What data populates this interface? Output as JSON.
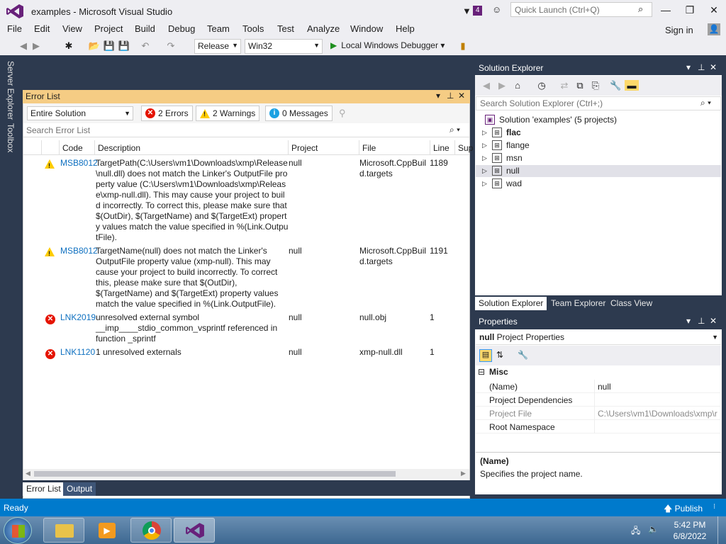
{
  "window": {
    "title": "examples - Microsoft Visual Studio",
    "notification_count": "4",
    "quick_launch_placeholder": "Quick Launch (Ctrl+Q)"
  },
  "menu": [
    "File",
    "Edit",
    "View",
    "Project",
    "Build",
    "Debug",
    "Team",
    "Tools",
    "Test",
    "Analyze",
    "Window",
    "Help"
  ],
  "signin": "Sign in",
  "toolbar": {
    "config": "Release",
    "platform": "Win32",
    "debugger": "Local Windows Debugger"
  },
  "side_tabs": [
    "Server Explorer",
    "Toolbox"
  ],
  "error_list": {
    "title": "Error List",
    "scope": "Entire Solution",
    "errors_filter": "2 Errors",
    "warnings_filter": "2 Warnings",
    "messages_filter": "0 Messages",
    "search_placeholder": "Search Error List",
    "columns": [
      "Code",
      "Description",
      "Project",
      "File",
      "Line",
      "Sup"
    ],
    "rows": [
      {
        "severity": "warning",
        "code": "MSB8012",
        "description": "TargetPath(C:\\Users\\vm1\\Downloads\\xmp\\Release\\null.dll) does not match the Linker's OutputFile property value (C:\\Users\\vm1\\Downloads\\xmp\\Release\\xmp-null.dll). This may cause your project to build incorrectly. To correct this, please make sure that $(OutDir), $(TargetName) and $(TargetExt) property values match the value specified in %(Link.OutputFile).",
        "project": "null",
        "file": "Microsoft.CppBuild.targets",
        "line": "1189"
      },
      {
        "severity": "warning",
        "code": "MSB8012",
        "description": "TargetName(null) does not match the Linker's OutputFile property value (xmp-null). This may cause your project to build incorrectly. To correct this, please make sure that $(OutDir), $(TargetName) and $(TargetExt) property values match the value specified in %(Link.OutputFile).",
        "project": "null",
        "file": "Microsoft.CppBuild.targets",
        "line": "1191"
      },
      {
        "severity": "error",
        "code": "LNK2019",
        "description": "unresolved external symbol __imp____stdio_common_vsprintf referenced in function _sprintf",
        "project": "null",
        "file": "null.obj",
        "line": "1"
      },
      {
        "severity": "error",
        "code": "LNK1120",
        "description": "1 unresolved externals",
        "project": "null",
        "file": "xmp-null.dll",
        "line": "1"
      }
    ],
    "bottom_tabs": [
      "Error List",
      "Output"
    ]
  },
  "solution_explorer": {
    "title": "Solution Explorer",
    "search_placeholder": "Search Solution Explorer (Ctrl+;)",
    "solution": "Solution 'examples' (5 projects)",
    "projects": [
      "flac",
      "flange",
      "msn",
      "null",
      "wad"
    ],
    "tabs": [
      "Solution Explorer",
      "Team Explorer",
      "Class View"
    ]
  },
  "properties": {
    "title": "Properties",
    "object_name": "null",
    "object_type": "Project Properties",
    "category": "Misc",
    "rows": [
      {
        "key": "(Name)",
        "value": "null"
      },
      {
        "key": "Project Dependencies",
        "value": ""
      },
      {
        "key": "Project File",
        "value": "C:\\Users\\vm1\\Downloads\\xmp\\r"
      },
      {
        "key": "Root Namespace",
        "value": ""
      }
    ],
    "desc_title": "(Name)",
    "desc_text": "Specifies the project name."
  },
  "status": {
    "text": "Ready",
    "publish": "Publish"
  },
  "taskbar": {
    "time": "5:42 PM",
    "date": "6/8/2022"
  }
}
